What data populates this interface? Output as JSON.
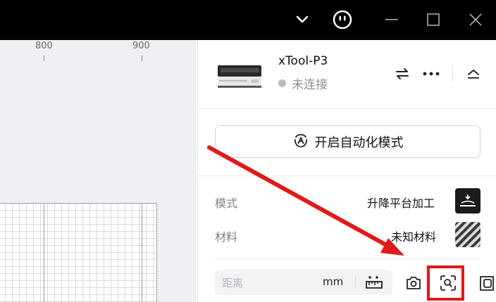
{
  "ruler": {
    "labels": [
      "800",
      "900"
    ]
  },
  "device": {
    "name": "xTool-P3",
    "status": "未连接"
  },
  "actions": {
    "auto_mode_label": "开启自动化模式"
  },
  "settings": {
    "mode_label": "模式",
    "mode_value": "升降平台加工",
    "material_label": "材料",
    "material_value": "未知材料"
  },
  "distance": {
    "placeholder": "距离",
    "unit": "mm"
  },
  "colors": {
    "titlebar": "#000000",
    "annotation": "#e11919"
  },
  "icons": [
    "chevron-down-icon",
    "smiley-icon",
    "minimize-icon",
    "maximize-icon",
    "close-icon",
    "swap-icon",
    "more-icon",
    "collapse-icon",
    "auto-mode-icon",
    "lift-platform-icon",
    "material-pattern-icon",
    "measure-icon",
    "camera-icon",
    "focus-scan-icon",
    "frame-icon"
  ]
}
